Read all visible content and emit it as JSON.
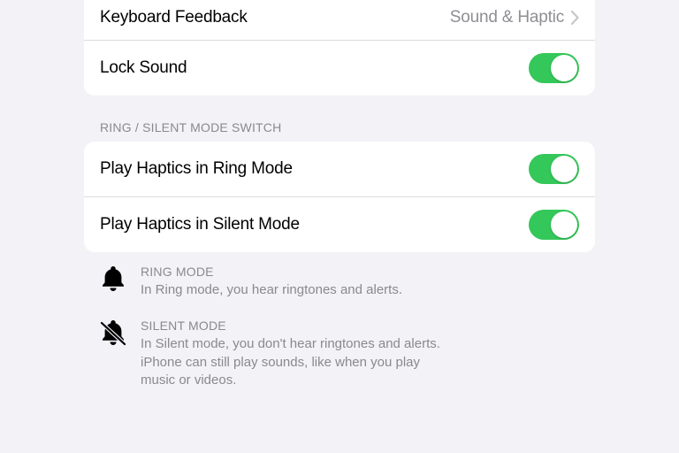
{
  "section1": {
    "keyboardFeedback": {
      "label": "Keyboard Feedback",
      "value": "Sound & Haptic"
    },
    "lockSound": {
      "label": "Lock Sound"
    }
  },
  "section2": {
    "header": "RING / SILENT MODE SWITCH",
    "playHapticsRing": {
      "label": "Play Haptics in Ring Mode"
    },
    "playHapticsSilent": {
      "label": "Play Haptics in Silent Mode"
    }
  },
  "info": {
    "ringMode": {
      "title": "RING MODE",
      "desc": "In Ring mode, you hear ringtones and alerts."
    },
    "silentMode": {
      "title": "SILENT MODE",
      "desc": "In Silent mode, you don't hear ringtones and alerts. iPhone can still play sounds, like when you play music or videos."
    }
  }
}
